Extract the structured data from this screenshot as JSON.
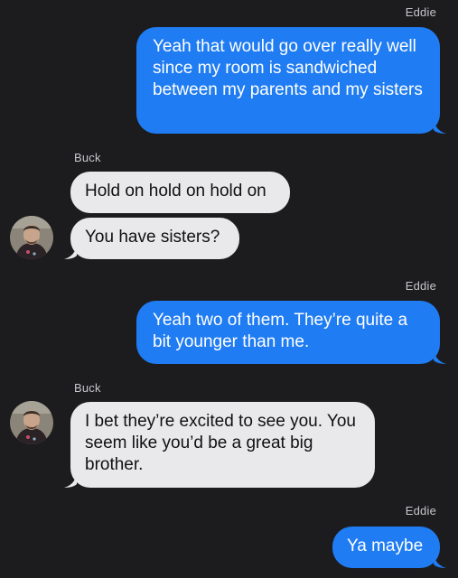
{
  "conversation": {
    "senders": {
      "eddie": "Eddie",
      "buck": "Buck"
    },
    "messages": [
      {
        "from": "Eddie",
        "text": "Yeah that would go over really well since my room is sandwiched between my parents and my sisters"
      },
      {
        "from": "Buck",
        "text": "Hold on hold on hold on"
      },
      {
        "from": "Buck",
        "text": "You have sisters?"
      },
      {
        "from": "Eddie",
        "text": "Yeah two of them. They’re quite a bit younger than me."
      },
      {
        "from": "Buck",
        "text": "I bet they’re excited to see you. You seem like you’d be a great big brother."
      },
      {
        "from": "Eddie",
        "text": "Ya maybe"
      }
    ]
  },
  "colors": {
    "background": "#1c1c1e",
    "outgoing_bubble": "#1f7cf2",
    "incoming_bubble": "#e9e9eb",
    "sender_label": "#c7c7cc"
  },
  "icons": {
    "avatar": "contact-photo-icon"
  }
}
